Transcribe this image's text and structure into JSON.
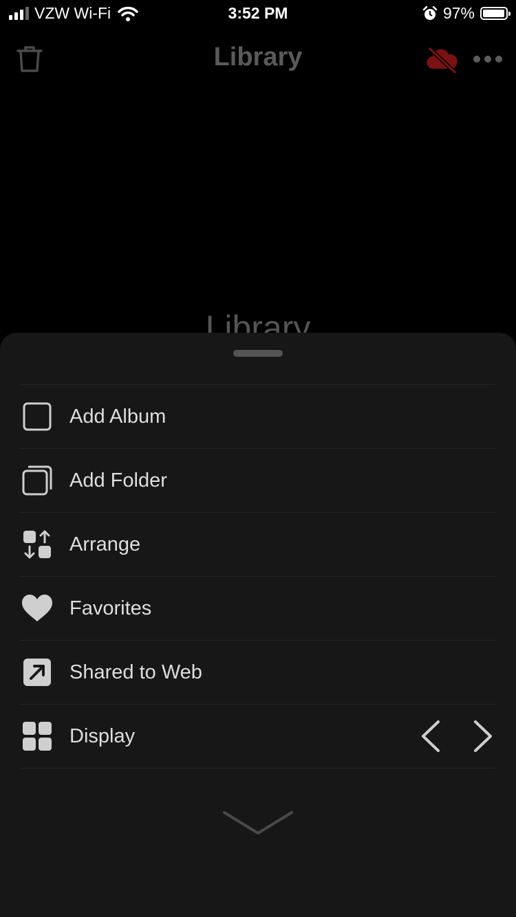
{
  "status_bar": {
    "carrier": "VZW Wi-Fi",
    "time": "3:52 PM",
    "battery_percent": "97%",
    "battery_level": 0.97,
    "icons": [
      "signal-bars-icon",
      "wifi-icon",
      "alarm-icon",
      "battery-icon"
    ]
  },
  "nav": {
    "title": "Library",
    "left_icon": "trash-icon",
    "right_icons": [
      "cloud-off-icon",
      "more-icon"
    ],
    "cloud_off_color": "#7a1212"
  },
  "background": {
    "heading": "Library"
  },
  "sheet": {
    "menu_items": [
      {
        "label": "Add Album",
        "icon": "square-outline-icon"
      },
      {
        "label": "Add Folder",
        "icon": "stacked-squares-icon"
      },
      {
        "label": "Arrange",
        "icon": "arrange-icon"
      },
      {
        "label": "Favorites",
        "icon": "heart-icon"
      },
      {
        "label": "Shared to Web",
        "icon": "share-arrow-icon"
      },
      {
        "label": "Display",
        "icon": "grid-icon"
      }
    ],
    "display_controls": [
      "chevron-left-icon",
      "chevron-right-icon"
    ],
    "collapse_icon": "chevron-down-icon"
  }
}
